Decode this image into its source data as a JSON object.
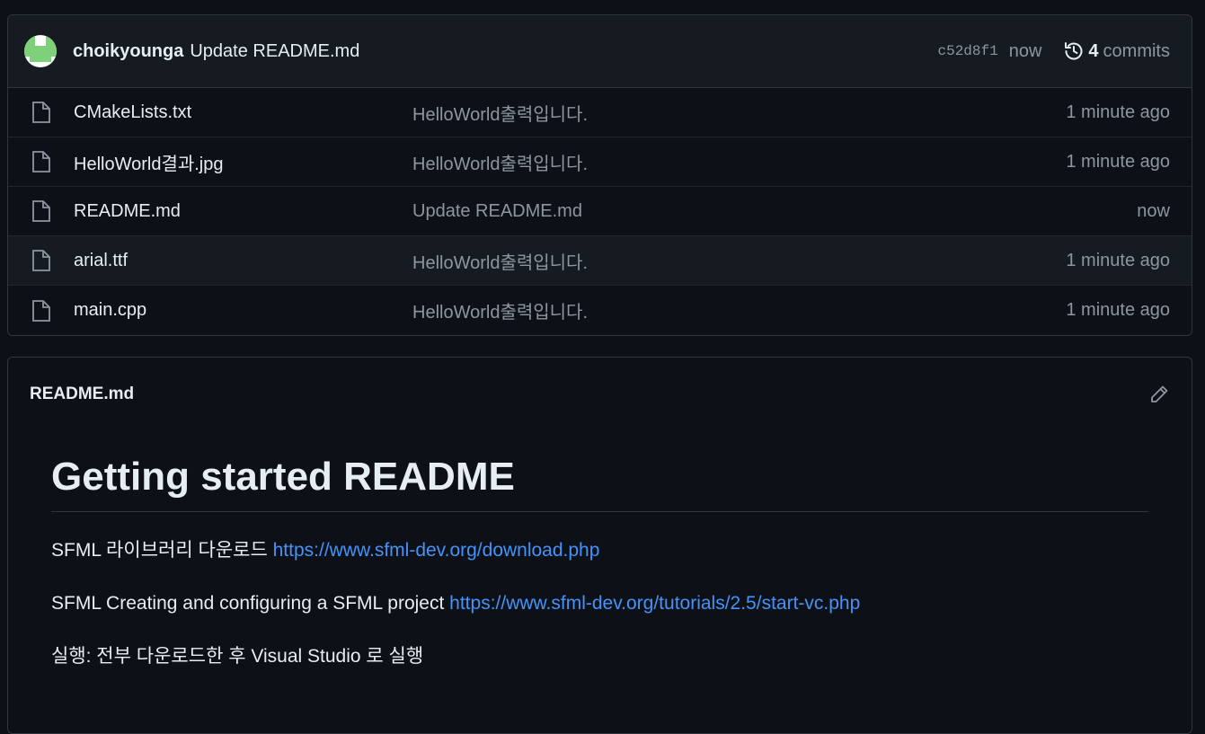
{
  "commit": {
    "author": "choikyounga",
    "message": "Update README.md",
    "sha": "c52d8f1",
    "time": "now",
    "commits_count": "4",
    "commits_label": "commits"
  },
  "files": [
    {
      "name": "CMakeLists.txt",
      "message": "HelloWorld출력입니다.",
      "time": "1 minute ago"
    },
    {
      "name": "HelloWorld결과.jpg",
      "message": "HelloWorld출력입니다.",
      "time": "1 minute ago"
    },
    {
      "name": "README.md",
      "message": "Update README.md",
      "time": "now"
    },
    {
      "name": "arial.ttf",
      "message": "HelloWorld출력입니다.",
      "time": "1 minute ago"
    },
    {
      "name": "main.cpp",
      "message": "HelloWorld출력입니다.",
      "time": "1 minute ago"
    }
  ],
  "readme": {
    "filename": "README.md",
    "heading": "Getting started README",
    "p1_text": "SFML 라이브러리 다운로드",
    "p1_link": "https://www.sfml-dev.org/download.php",
    "p2_text": "SFML Creating and configuring a SFML project",
    "p2_link": "https://www.sfml-dev.org/tutorials/2.5/start-vc.php",
    "p3_text": "실행: 전부 다운로드한 후 Visual Studio 로 실행"
  },
  "colors": {
    "background": "#0d1117",
    "header_bg": "#161b22",
    "border": "#30363d",
    "link": "#4493f8",
    "muted": "#8d96a0"
  },
  "icons": [
    "file-icon",
    "history-icon",
    "pencil-icon",
    "avatar-identicon"
  ]
}
